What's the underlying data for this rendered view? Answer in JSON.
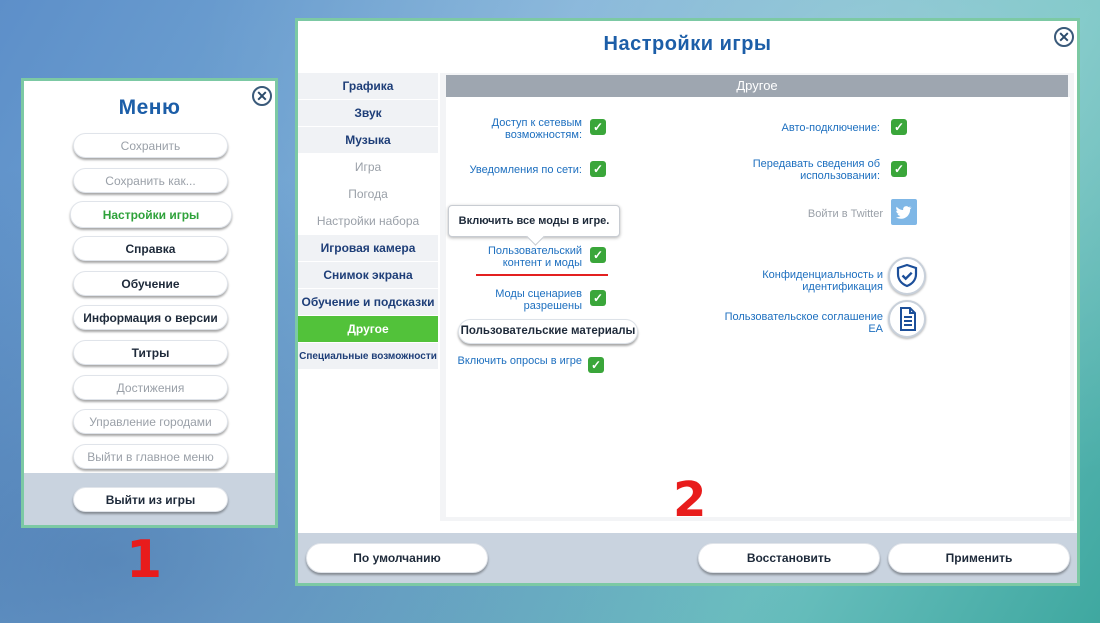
{
  "menu": {
    "title": "Меню",
    "items": [
      {
        "label": "Сохранить",
        "state": "disabled"
      },
      {
        "label": "Сохранить как...",
        "state": "disabled"
      },
      {
        "label": "Настройки игры",
        "state": "active"
      },
      {
        "label": "Справка",
        "state": "enabled"
      },
      {
        "label": "Обучение",
        "state": "enabled"
      },
      {
        "label": "Информация о версии",
        "state": "enabled"
      },
      {
        "label": "Титры",
        "state": "enabled"
      },
      {
        "label": "Достижения",
        "state": "disabled"
      },
      {
        "label": "Управление городами",
        "state": "disabled"
      },
      {
        "label": "Выйти в главное меню",
        "state": "disabled"
      }
    ],
    "exit_label": "Выйти из игры"
  },
  "annotations": {
    "one": "1",
    "two": "2"
  },
  "settings": {
    "title": "Настройки игры",
    "sidebar": [
      {
        "label": "Графика",
        "state": "enabled"
      },
      {
        "label": "Звук",
        "state": "enabled"
      },
      {
        "label": "Музыка",
        "state": "enabled"
      },
      {
        "label": "Игра",
        "state": "disabled"
      },
      {
        "label": "Погода",
        "state": "disabled"
      },
      {
        "label": "Настройки набора",
        "state": "disabled"
      },
      {
        "label": "Игровая камера",
        "state": "enabled"
      },
      {
        "label": "Снимок экрана",
        "state": "enabled"
      },
      {
        "label": "Обучение и подсказки",
        "state": "enabled"
      },
      {
        "label": "Другое",
        "state": "active"
      },
      {
        "label": "Специальные возможности",
        "state": "enabled"
      }
    ],
    "section_title": "Другое",
    "left_options": [
      {
        "label": "Доступ к сетевым возможностям:",
        "checked": true
      },
      {
        "label": "Уведомления по сети:",
        "checked": true
      },
      {
        "label": "Пользовательский контент и моды",
        "checked": true
      },
      {
        "label": "Моды сценариев разрешены",
        "checked": true
      },
      {
        "label": "Включить опросы в игре",
        "checked": true
      }
    ],
    "tooltip": "Включить все моды в игре.",
    "custom_materials_button": "Пользовательские материалы",
    "right_options": [
      {
        "label": "Авто-подключение:",
        "checked": true
      },
      {
        "label": "Передавать сведения об использовании:",
        "checked": true
      },
      {
        "label": "Войти в Twitter",
        "icon": "twitter-icon"
      },
      {
        "label": "Конфиденциальность и идентификация",
        "icon": "shield-check-icon"
      },
      {
        "label": "Пользовательское соглашение EA",
        "icon": "document-icon"
      }
    ],
    "footer": {
      "default_label": "По умолчанию",
      "restore_label": "Восстановить",
      "apply_label": "Применить"
    },
    "colors": {
      "accent_green": "#52c23a",
      "title_blue": "#1c5ea8",
      "check_green": "#3aa63a"
    }
  }
}
